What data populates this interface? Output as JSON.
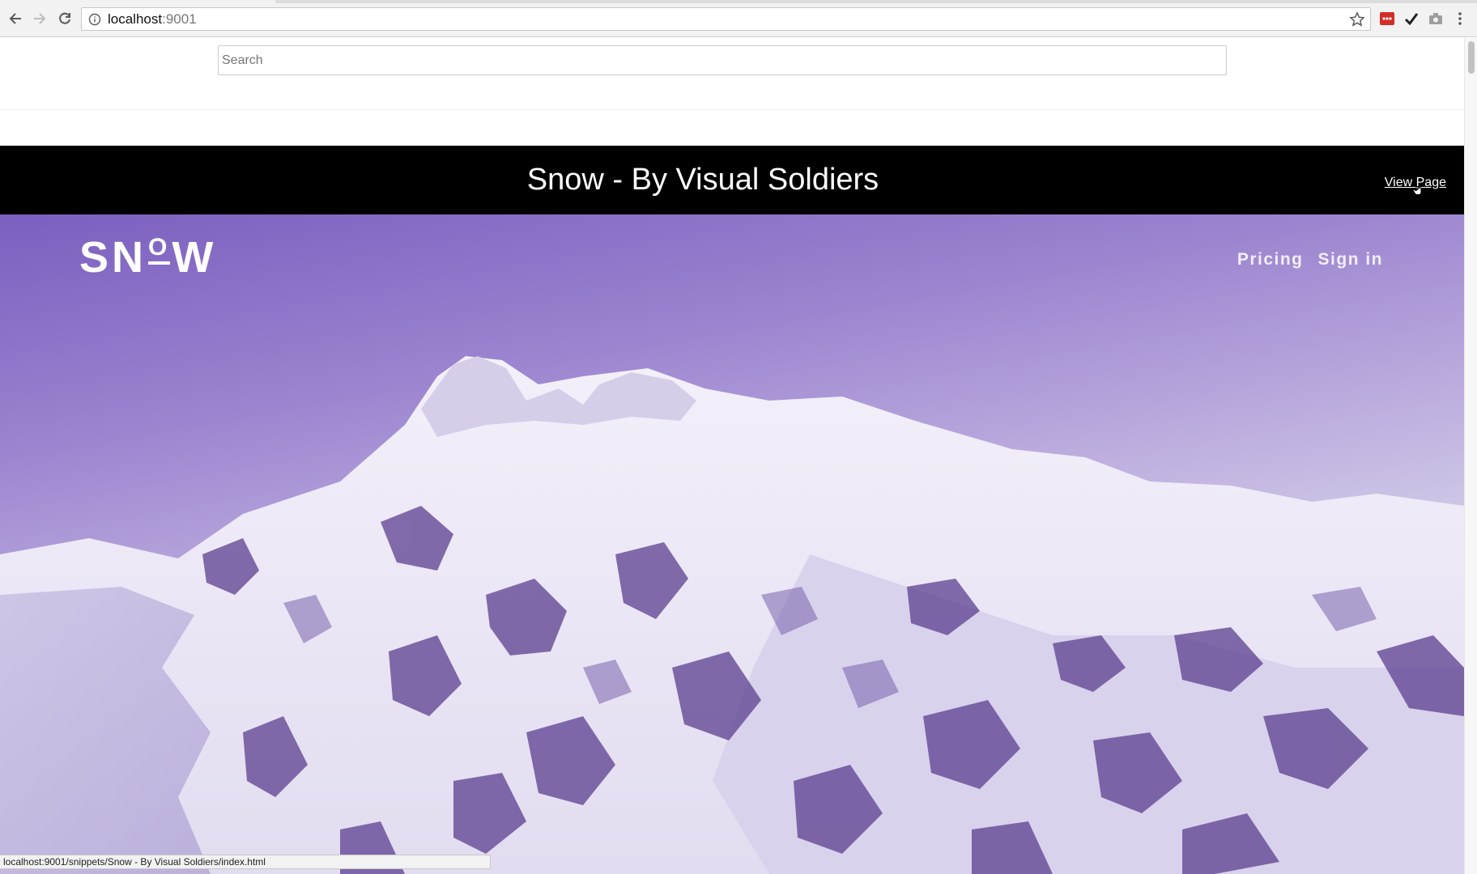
{
  "browser": {
    "url_host": "localhost",
    "url_port": ":9001",
    "status_url": "localhost:9001/snippets/Snow - By Visual Soldiers/index.html"
  },
  "search": {
    "placeholder": "Search"
  },
  "snippet": {
    "title": "Snow - By Visual Soldiers",
    "view_link": "View Page"
  },
  "hero": {
    "logo_left": "SN",
    "logo_o": "O",
    "logo_right": "W",
    "nav": [
      "Pricing",
      "Sign in"
    ]
  },
  "colors": {
    "accent_purple": "#7b5fbf",
    "snippet_bar": "#000000",
    "snow_shadow": "#5b3f8f"
  },
  "icons": {
    "back": "arrow-left-icon",
    "forward": "arrow-right-icon",
    "reload": "reload-icon",
    "info": "info-icon",
    "bookmark": "star-icon",
    "extensions": [
      "lastpass-icon",
      "checkmark-icon",
      "camera-icon",
      "menu-dots-icon"
    ]
  }
}
